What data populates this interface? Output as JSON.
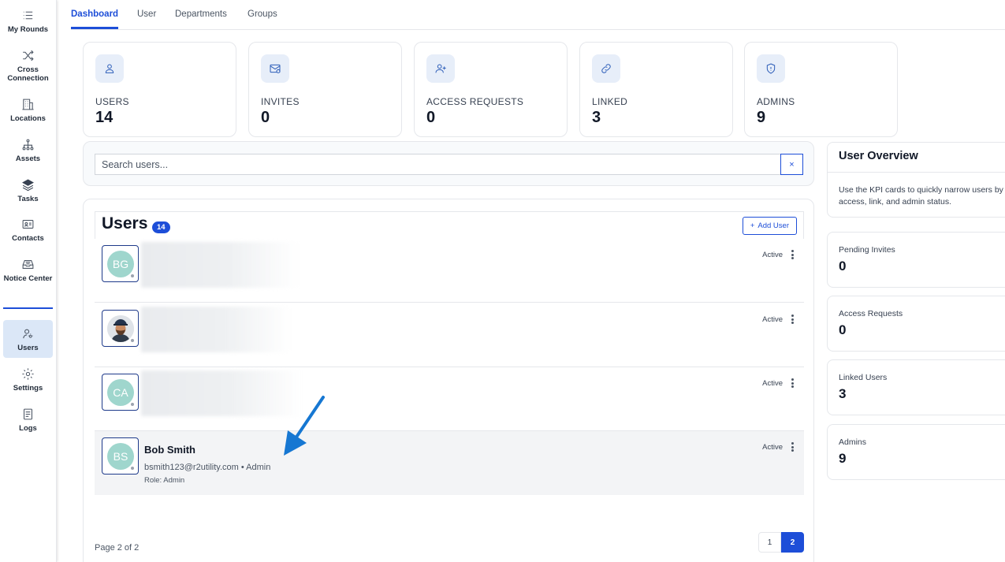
{
  "sidebar": {
    "items": [
      {
        "label": "My Rounds",
        "icon": "list-icon"
      },
      {
        "label": "Cross Connection",
        "icon": "shuffle-icon"
      },
      {
        "label": "Locations",
        "icon": "building-icon"
      },
      {
        "label": "Assets",
        "icon": "hierarchy-icon"
      },
      {
        "label": "Tasks",
        "icon": "layers-icon"
      },
      {
        "label": "Contacts",
        "icon": "contact-card-icon"
      },
      {
        "label": "Notice Center",
        "icon": "inbox-icon"
      },
      {
        "label": "Users",
        "icon": "user-gear-icon",
        "active": true
      },
      {
        "label": "Settings",
        "icon": "gear-icon"
      },
      {
        "label": "Logs",
        "icon": "log-icon"
      }
    ]
  },
  "tabs": [
    {
      "label": "Dashboard",
      "active": true
    },
    {
      "label": "User"
    },
    {
      "label": "Departments"
    },
    {
      "label": "Groups"
    }
  ],
  "kpis": [
    {
      "label": "USERS",
      "value": "14",
      "icon": "user-icon"
    },
    {
      "label": "INVITES",
      "value": "0",
      "icon": "mail-icon"
    },
    {
      "label": "ACCESS REQUESTS",
      "value": "0",
      "icon": "user-plus-icon"
    },
    {
      "label": "LINKED",
      "value": "3",
      "icon": "link-icon"
    },
    {
      "label": "ADMINS",
      "value": "9",
      "icon": "shield-icon"
    }
  ],
  "search": {
    "placeholder": "Search users...",
    "clear": "×"
  },
  "users": {
    "title": "Users",
    "count": "14",
    "add_label": "Add User",
    "add_icon": "+",
    "rows": [
      {
        "initials": "BG",
        "status": "Active",
        "blurred": true
      },
      {
        "initials": "",
        "status": "Active",
        "blurred": true,
        "photo": true
      },
      {
        "initials": "CA",
        "status": "Active",
        "blurred": true
      },
      {
        "initials": "BS",
        "status": "Active",
        "name": "Bob Smith",
        "email": "bsmith123@r2utility.com • Admin",
        "role": "Role: Admin"
      }
    ],
    "page_info": "Page 2 of 2",
    "pages": [
      "1",
      "2"
    ]
  },
  "overview": {
    "title": "User Overview",
    "description": "Use the KPI cards to quickly narrow users by access, link, and admin status.",
    "stats": [
      {
        "label": "Pending Invites",
        "value": "0"
      },
      {
        "label": "Access Requests",
        "value": "0"
      },
      {
        "label": "Linked Users",
        "value": "3"
      },
      {
        "label": "Admins",
        "value": "9"
      }
    ]
  },
  "colors": {
    "accent": "#1d4ed8",
    "avatar": "#9fd6cd",
    "annotation_arrow": "#1677d2"
  }
}
